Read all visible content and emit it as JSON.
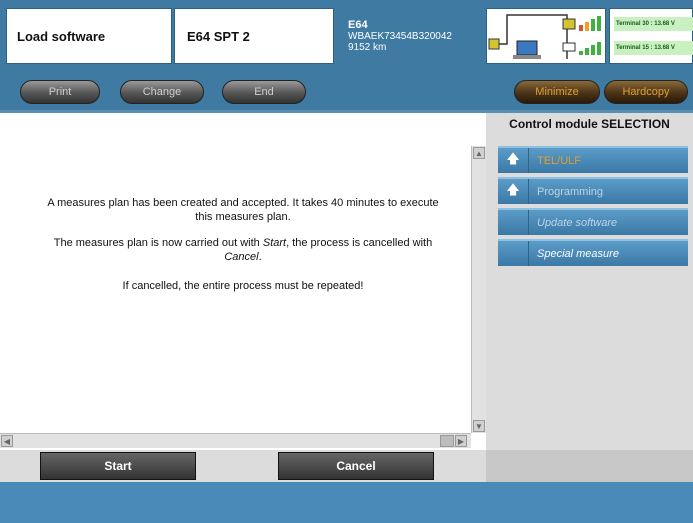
{
  "header": {
    "function_title": "Load software",
    "model_code": "E64 SPT 2",
    "vehicle": {
      "series": "E64",
      "vin": "WBAEK73454B320042",
      "mileage": "9152 km"
    },
    "terminals": [
      "Terminal 30 : 13.68 V",
      "Terminal 15 : 13.68 V"
    ]
  },
  "toolbar": {
    "print": "Print",
    "change": "Change",
    "end": "End",
    "minimize": "Minimize",
    "hardcopy": "Hardcopy"
  },
  "main": {
    "line1": "A measures plan has been created and accepted. It takes 40 minutes to execute",
    "line1b": "this measures plan.",
    "line2_pre": "The measures plan is now carried out with ",
    "line2_start": "Start",
    "line2_mid": ", the process is cancelled with",
    "line2_cancel": "Cancel",
    "line2_end": ".",
    "line3": "If cancelled, the entire process must be repeated!"
  },
  "right_panel": {
    "title": "Control module SELECTION",
    "items": [
      {
        "label": "TEL/ULF",
        "icon": "up-arrow-icon"
      },
      {
        "label": "Programming",
        "icon": "up-arrow-icon"
      },
      {
        "label": "Update software",
        "icon": ""
      },
      {
        "label": "Special measure",
        "icon": ""
      }
    ]
  },
  "actions": {
    "start": "Start",
    "cancel": "Cancel"
  },
  "colors": {
    "header_blue": "#3f7aa3",
    "accent_orange": "#e0a030",
    "panel_grey": "#dcdcdc"
  }
}
